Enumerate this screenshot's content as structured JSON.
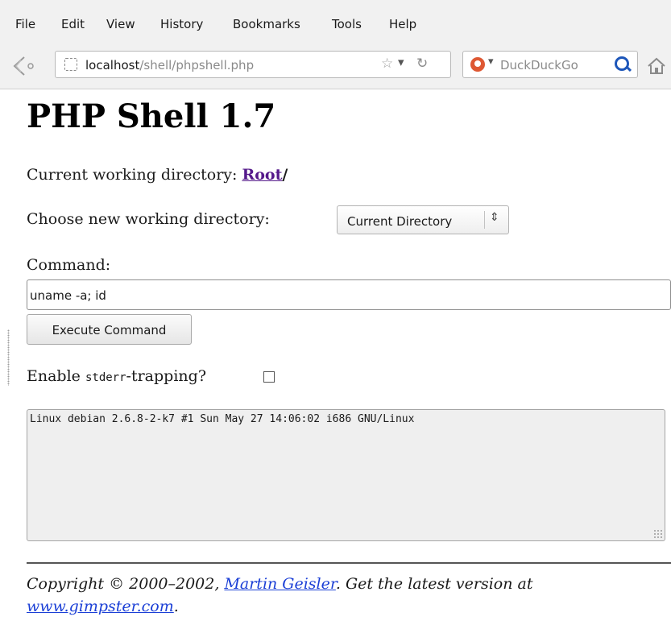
{
  "menu": {
    "file": "File",
    "edit": "Edit",
    "view": "View",
    "history": "History",
    "bookmarks": "Bookmarks",
    "tools": "Tools",
    "help": "Help"
  },
  "urlbar": {
    "host": "localhost",
    "path": "/shell/phpshell.php"
  },
  "searchbar": {
    "placeholder": "DuckDuckGo"
  },
  "page": {
    "title": "PHP Shell 1.7",
    "cwd_label": "Current working directory: ",
    "cwd_link": "Root",
    "cwd_sep": "/",
    "choose_label": "Choose new working directory:",
    "dir_select_value": "Current Directory",
    "command_label": "Command:",
    "command_value": "uname -a; id",
    "execute_label": "Execute Command",
    "stderr_prefix": "Enable ",
    "stderr_code": "stderr",
    "stderr_suffix": "-trapping?",
    "output": "Linux debian 2.6.8-2-k7 #1 Sun May 27 14:06:02 i686 GNU/Linux",
    "footer_prefix": "Copyright © 2000–2002, ",
    "footer_author": "Martin Geisler",
    "footer_middle": ". Get the latest version at ",
    "footer_site": "www.gimpster.com",
    "footer_end": "."
  },
  "colors": {
    "visited_link": "#551a8b",
    "footer_link": "#1b3fd6",
    "search_brand": "#de5833"
  },
  "icons": [
    "back-icon",
    "site-identity-icon",
    "bookmark-star-icon",
    "url-dropdown-icon",
    "reload-icon",
    "duckduckgo-icon",
    "search-icon",
    "home-icon",
    "select-arrows-icon"
  ]
}
